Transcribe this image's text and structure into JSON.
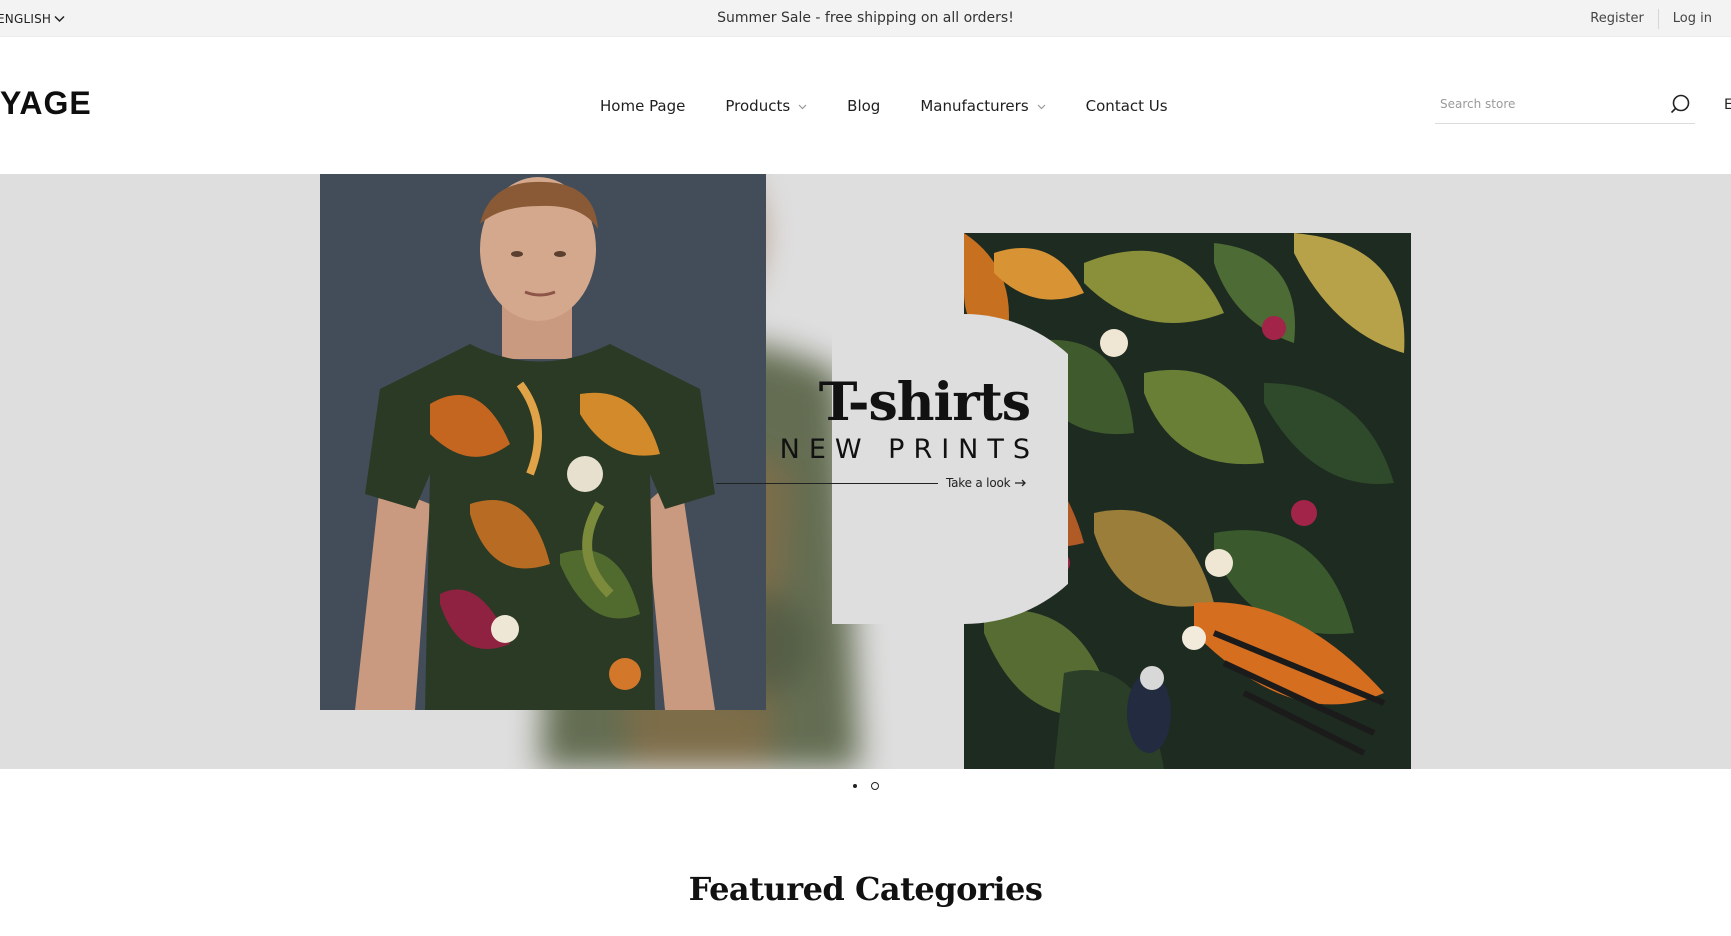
{
  "topbar": {
    "language": "ENGLISH",
    "promo": "Summer Sale - free shipping on all orders!",
    "register": "Register",
    "login": "Log in"
  },
  "header": {
    "logo": "YAGE",
    "nav": [
      "Home Page",
      "Products",
      "Blog",
      "Manufacturers",
      "Contact Us"
    ],
    "search_placeholder": "Search store",
    "cut_off_text": "E"
  },
  "hero": {
    "title": "T-shirts",
    "subtitle": "NEW PRINTS",
    "cta": "Take a look"
  },
  "slider": {
    "slide_count": 2,
    "active_index": 0
  },
  "section": {
    "title": "Featured Categories"
  },
  "colors": {
    "topbar_bg": "#f3f3f3",
    "hero_bg": "#dedede",
    "text": "#111111"
  }
}
